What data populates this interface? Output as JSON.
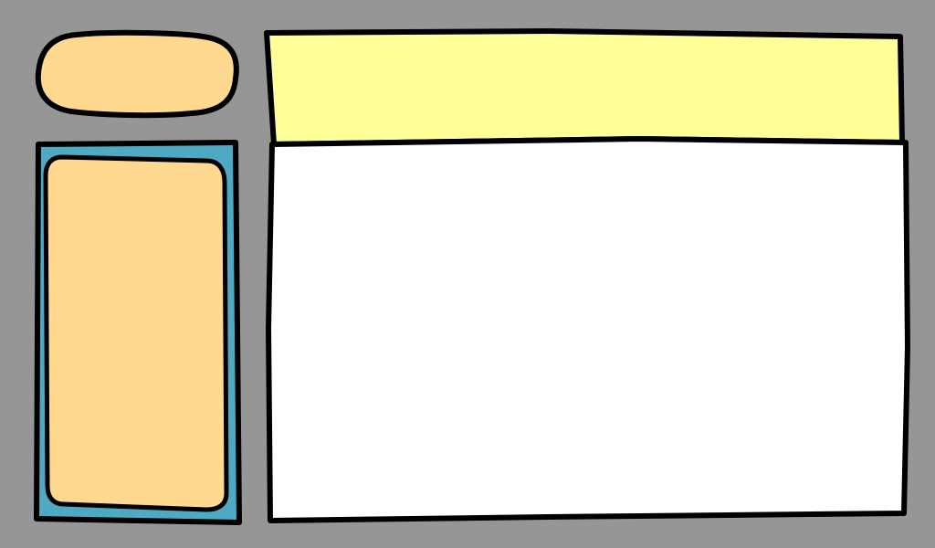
{
  "colors": {
    "background": "#969696",
    "outline": "#000000",
    "left_pill_fill": "#FFD990",
    "left_panel_border_fill": "#4EA9C2",
    "left_card_fill": "#FFD990",
    "header_fill": "#FFFF99",
    "content_fill": "#FFFFFF"
  },
  "regions": {
    "left_top_pill": {
      "label": ""
    },
    "left_panel": {
      "label": ""
    },
    "left_inner_card": {
      "label": ""
    },
    "header_band": {
      "label": ""
    },
    "main_content": {
      "label": ""
    }
  }
}
